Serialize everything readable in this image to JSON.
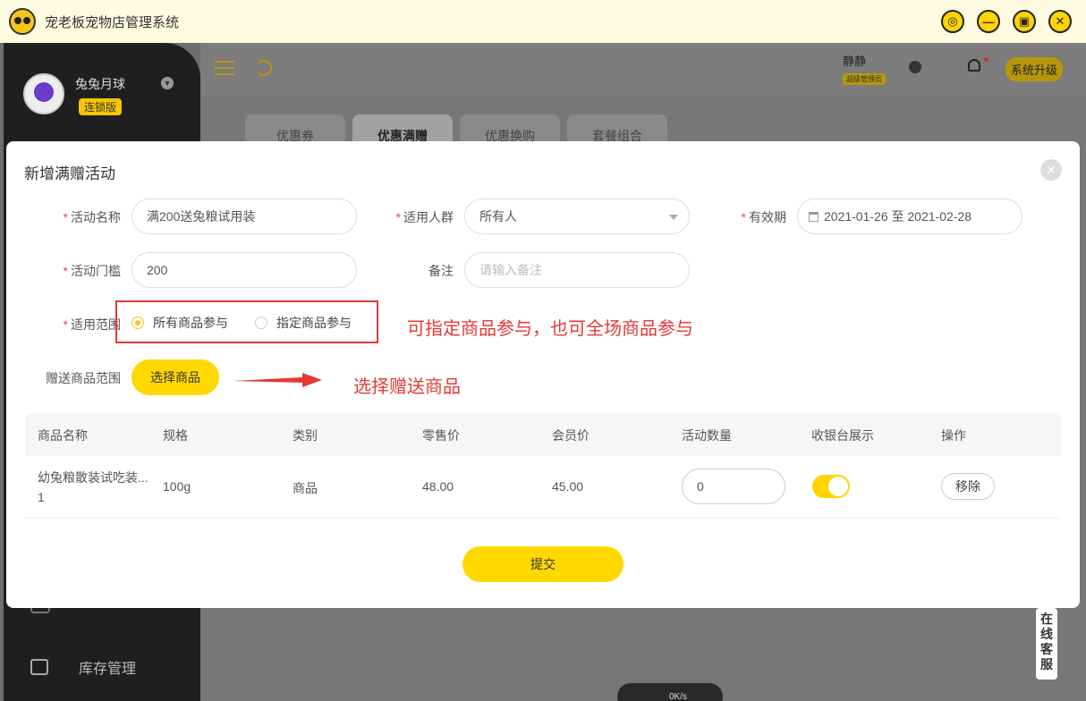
{
  "app": {
    "title": "宠老板宠物店管理系统"
  },
  "sidebar": {
    "store_name": "兔兔月球",
    "store_badge": "连锁版",
    "item_inventory": "库存管理"
  },
  "topbar": {
    "user_name": "静静",
    "user_role": "超级管理员",
    "upgrade_label": "系统升级"
  },
  "tabs": [
    {
      "label": "优惠券"
    },
    {
      "label": "优惠满赠",
      "active": true
    },
    {
      "label": "优惠换购"
    },
    {
      "label": "套餐组合"
    }
  ],
  "modal": {
    "title": "新增满赠活动",
    "fields": {
      "activity_name": {
        "label": "活动名称",
        "value": "满200送兔粮试用装"
      },
      "audience": {
        "label": "适用人群",
        "value": "所有人"
      },
      "validity": {
        "label": "有效期",
        "value": "2021-01-26 至 2021-02-28"
      },
      "threshold": {
        "label": "活动门槛",
        "value": "200"
      },
      "remark": {
        "label": "备注",
        "placeholder": "请输入备注"
      },
      "scope": {
        "label": "适用范围",
        "option_all": "所有商品参与",
        "option_specified": "指定商品参与",
        "selected": "all"
      },
      "gift_scope": {
        "label": "赠送商品范围",
        "button": "选择商品"
      }
    },
    "annotations": {
      "scope_note": "可指定商品参与，也可全场商品参与",
      "gift_note": "选择赠送商品"
    },
    "table": {
      "headers": [
        "商品名称",
        "规格",
        "类别",
        "零售价",
        "会员价",
        "活动数量",
        "收银台展示",
        "操作"
      ],
      "rows": [
        {
          "name": "幼兔粮散装试吃装...",
          "name_line2": "1",
          "spec": "100g",
          "category": "商品",
          "retail_price": "48.00",
          "member_price": "45.00",
          "quantity": "0",
          "pos_display": true,
          "action": "移除"
        }
      ]
    },
    "submit_label": "提交"
  },
  "widgets": {
    "chat": "在线客服",
    "speed": "0K/s"
  },
  "colors": {
    "accent": "#ffd800",
    "annotation": "#e53935"
  }
}
